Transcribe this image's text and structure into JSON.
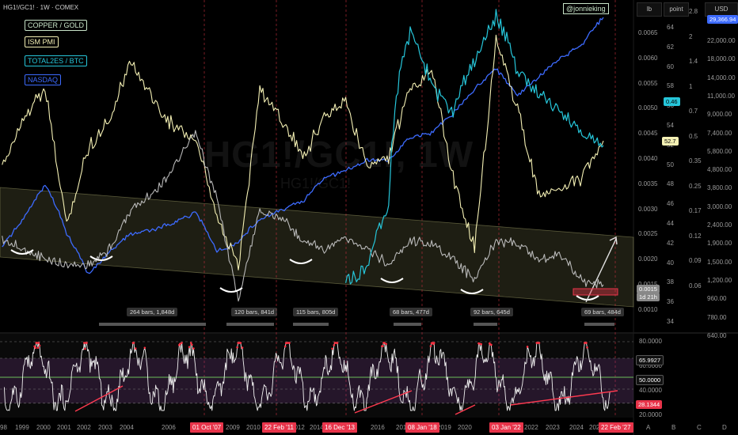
{
  "header": {
    "title": "HG1!/GC1! · 1W · COMEX",
    "author_badge": "@jonnieking",
    "unit_lb": "lb",
    "unit_point": "point",
    "unit_usd": "USD",
    "watermark_big": "HG1!/GC1!, 1W",
    "watermark_small": "HG1!/GC1!"
  },
  "legend": [
    {
      "label": "COPPER / GOLD",
      "color": "#c9e5c9"
    },
    {
      "label": "ISM PMI",
      "color": "#f4f0b4"
    },
    {
      "label": "TOTAL2ES / BTC",
      "color": "#26c6da"
    },
    {
      "label": "NASDAQ",
      "color": "#3d6bff"
    }
  ],
  "axes": {
    "ratio_ticks": [
      "0.0065",
      "0.0060",
      "0.0055",
      "0.0050",
      "0.0045",
      "0.0040",
      "0.0035",
      "0.0030",
      "0.0025",
      "0.0020",
      "0.0015",
      "0.0010"
    ],
    "pmi_ticks": [
      "64",
      "62",
      "60",
      "58",
      "56",
      "54",
      "52",
      "50",
      "48",
      "46",
      "44",
      "42",
      "40",
      "38",
      "36",
      "34"
    ],
    "point_ticks": [
      "2.8",
      "2",
      "1.4",
      "1",
      "0.7",
      "0.5",
      "0.35",
      "0.25",
      "0.17",
      "0.12",
      "0.09",
      "0.06"
    ],
    "usd_ticks": [
      "22,000.00",
      "18,000.00",
      "14,000.00",
      "11,000.00",
      "9,000.00",
      "7,400.00",
      "5,800.00",
      "4,800.00",
      "3,800.00",
      "3,000.00",
      "2,400.00",
      "1,900.00",
      "1,500.00",
      "1,200.00",
      "960.00",
      "780.00",
      "640.00"
    ],
    "rsi_ticks": [
      "80.0000",
      "60.0000",
      "40.0000",
      "20.0000"
    ],
    "x_labels": [
      "98",
      "1999",
      "2000",
      "2001",
      "2002",
      "2003",
      "2004",
      "2006",
      "2009",
      "2010",
      "2012",
      "2014",
      "2016",
      "2017",
      "2019",
      "2020",
      "2022",
      "2023",
      "2024",
      "2025",
      "2026",
      "A",
      "B",
      "C",
      "D"
    ],
    "x_red_labels": [
      "01 Oct '07",
      "22 Feb '11",
      "16 Dec '13",
      "08 Jan '18",
      "03 Jan '22",
      "22 Feb '27"
    ]
  },
  "price_tags": {
    "nasdaq_last": "29,366.94",
    "btc_ratio_last": "0.46",
    "pmi_last": "52.7",
    "ratio_last": "0.0015",
    "ratio_countdown": "1d 21h"
  },
  "rsi_tags": {
    "upper": "65.9927",
    "mid": "50.0000",
    "lower": "28.1344"
  },
  "bar_ranges": [
    "264 bars, 1,848d",
    "120 bars, 841d",
    "115 bars, 805d",
    "68 bars, 477d",
    "92 bars, 645d",
    "69 bars, 484d"
  ],
  "chart_data": {
    "type": "line",
    "x": [
      "1998",
      "1999",
      "2000",
      "2001",
      "2002",
      "2003",
      "2004",
      "2005",
      "2006",
      "2007",
      "2008",
      "2009",
      "2010",
      "2011",
      "2012",
      "2013",
      "2014",
      "2015",
      "2016",
      "2017",
      "2018",
      "2019",
      "2020",
      "2021",
      "2022",
      "2023",
      "2024",
      "2025",
      "2026"
    ],
    "series": [
      {
        "name": "COPPER / GOLD",
        "axis": "lb",
        "values": [
          0.0024,
          0.0022,
          0.002,
          0.0019,
          0.0019,
          0.0022,
          0.003,
          0.0033,
          0.0038,
          0.0045,
          0.0032,
          0.0012,
          0.003,
          0.0028,
          0.0024,
          0.0022,
          0.0024,
          0.0022,
          0.0019,
          0.0024,
          0.0023,
          0.002,
          0.0016,
          0.0024,
          0.0023,
          0.002,
          0.0021,
          0.0016,
          0.0015
        ]
      },
      {
        "name": "ISM PMI",
        "axis": "point",
        "values": [
          50,
          55,
          58,
          44,
          52,
          55,
          61,
          57,
          54,
          53,
          45,
          40,
          58,
          55,
          51,
          55,
          57,
          50,
          51,
          58,
          60,
          49,
          42,
          63,
          56,
          47,
          48,
          49,
          52.7
        ]
      },
      {
        "name": "TOTAL2ES / BTC",
        "axis": "point",
        "values": [
          null,
          null,
          null,
          null,
          null,
          null,
          null,
          null,
          null,
          null,
          null,
          null,
          null,
          null,
          null,
          null,
          0.08,
          0.09,
          0.2,
          2.0,
          1.0,
          0.7,
          1.4,
          2.5,
          1.2,
          0.9,
          0.7,
          0.55,
          0.46
        ]
      },
      {
        "name": "NASDAQ",
        "axis": "USD",
        "values": [
          1700,
          2400,
          3700,
          2000,
          1200,
          1600,
          2000,
          2100,
          2300,
          2600,
          1600,
          1800,
          2400,
          2700,
          3000,
          4000,
          4400,
          5000,
          5000,
          6600,
          7000,
          8900,
          12000,
          15500,
          11000,
          14000,
          17500,
          21000,
          29366.94
        ]
      }
    ],
    "rsi": {
      "ylim": [
        20,
        80
      ],
      "levels": [
        65.9927,
        50.0,
        28.1344
      ]
    }
  }
}
